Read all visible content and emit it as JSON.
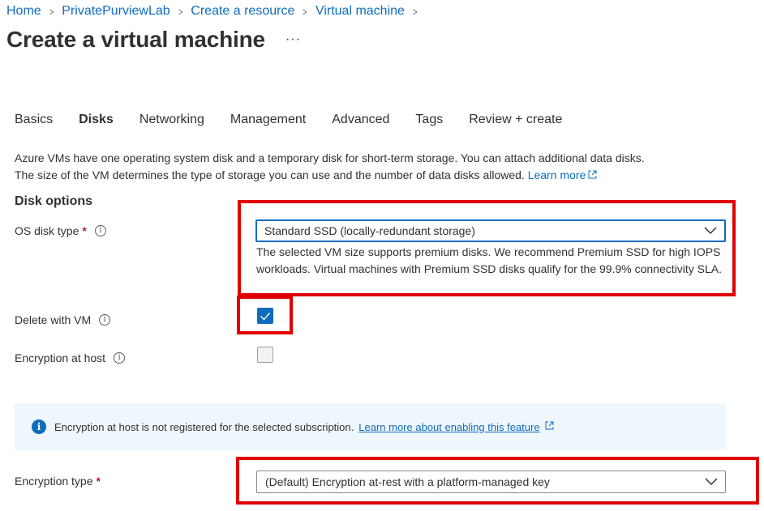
{
  "breadcrumb": [
    "Home",
    "PrivatePurviewLab",
    "Create a resource",
    "Virtual machine"
  ],
  "page": {
    "title": "Create a virtual machine",
    "more": "···"
  },
  "tabs": [
    {
      "label": "Basics",
      "active": false
    },
    {
      "label": "Disks",
      "active": true
    },
    {
      "label": "Networking",
      "active": false
    },
    {
      "label": "Management",
      "active": false
    },
    {
      "label": "Advanced",
      "active": false
    },
    {
      "label": "Tags",
      "active": false
    },
    {
      "label": "Review + create",
      "active": false
    }
  ],
  "description": {
    "line1": "Azure VMs have one operating system disk and a temporary disk for short-term storage. You can attach additional data disks.",
    "line2": "The size of the VM determines the type of storage you can use and the number of data disks allowed.",
    "link": "Learn more"
  },
  "disk_options": {
    "title": "Disk options",
    "os_disk_type": {
      "label": "OS disk type",
      "required": "*",
      "value": "Standard SSD (locally-redundant storage)",
      "helper": "The selected VM size supports premium disks. We recommend Premium SSD for high IOPS workloads. Virtual machines with Premium SSD disks qualify for the 99.9% connectivity SLA."
    },
    "delete_with_vm": {
      "label": "Delete with VM",
      "checked": true
    },
    "encryption_at_host": {
      "label": "Encryption at host",
      "checked": false
    }
  },
  "banner": {
    "text": "Encryption at host is not registered for the selected subscription.",
    "link": "Learn more about enabling this feature"
  },
  "encryption_type": {
    "label": "Encryption type",
    "required": "*",
    "value": "(Default) Encryption at-rest with a platform-managed key"
  },
  "colors": {
    "accent": "#0f6cbd",
    "highlight": "#e00000",
    "banner_bg": "#eff6fc",
    "required": "#a4262c"
  },
  "icons": [
    "chevron-right-icon",
    "more-icon",
    "info-icon",
    "external-link-icon",
    "chevron-down-icon",
    "checkmark-icon",
    "info-filled-icon"
  ]
}
